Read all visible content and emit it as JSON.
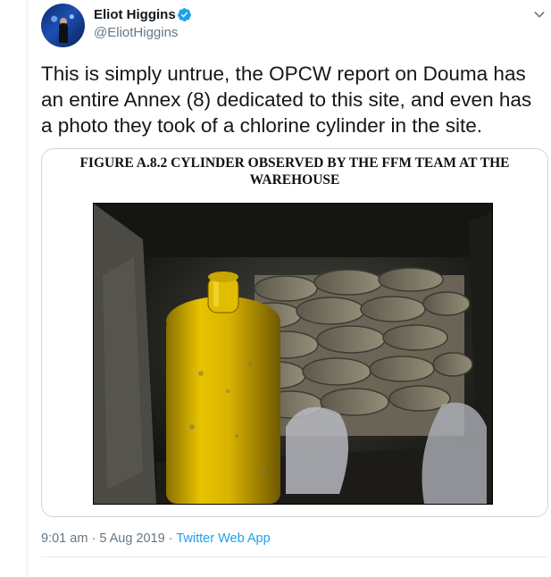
{
  "author": {
    "name": "Eliot Higgins",
    "handle": "@EliotHiggins",
    "verified": true
  },
  "tweet": {
    "text": "This is simply untrue, the OPCW report on Douma has an entire Annex (8) dedicated to this site, and even has a photo they took of a chlorine cylinder in the site."
  },
  "attachment": {
    "caption_line1": "FIGURE A.8.2 CYLINDER OBSERVED BY THE FFM TEAM AT THE",
    "caption_line2": "WAREHOUSE"
  },
  "footer": {
    "time": "9:01 am",
    "separator": "·",
    "date": "5 Aug 2019",
    "source": "Twitter Web App"
  },
  "colors": {
    "accent": "#1da1f2",
    "secondary_text": "#657786",
    "cylinder": "#d9b300"
  },
  "icons": {
    "verified": "verified-badge-icon",
    "menu": "chevron-down-icon"
  }
}
